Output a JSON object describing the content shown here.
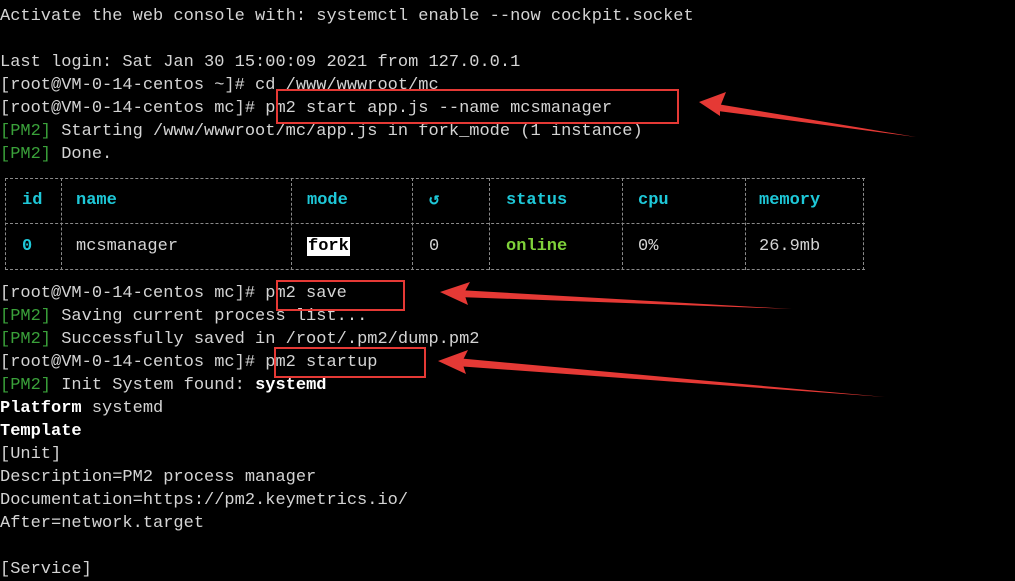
{
  "terminal": {
    "line_activate": "Activate the web console with: systemctl enable --now cockpit.socket",
    "line_lastlogin": "Last login: Sat Jan 30 15:00:09 2021 from 127.0.0.1",
    "prompt_home": "[root@VM-0-14-centos ~]#",
    "cmd_cd": " cd /www/wwwroot/mc",
    "prompt_mc": "[root@VM-0-14-centos mc]#",
    "cmd_start": " pm2 start app.js --name mcsmanager",
    "pm2_tag": "[PM2]",
    "starting_text": " Starting /www/wwwroot/mc/app.js in fork_mode (1 instance)",
    "done_text": " Done.",
    "cmd_save": " pm2 save",
    "saving_text": " Saving current process list...",
    "saved_text": " Successfully saved in /root/.pm2/dump.pm2",
    "cmd_startup": " pm2 startup",
    "init_text": " Init System found: ",
    "init_value": "systemd",
    "platform_label": "Platform",
    "platform_value": " systemd",
    "template_label": "Template",
    "unit_header": "[Unit]",
    "description_line": "Description=PM2 process manager",
    "documentation_line": "Documentation=https://pm2.keymetrics.io/",
    "after_line": "After=network.target",
    "service_header": "[Service]"
  },
  "process_table": {
    "headers": [
      "id",
      "name",
      "mode",
      "↺",
      "status",
      "cpu",
      "memory"
    ],
    "row": {
      "id": "0",
      "name": "mcsmanager",
      "mode": "fork",
      "restarts": "0",
      "status": "online",
      "cpu": "0%",
      "memory": "26.9mb"
    }
  },
  "colors": {
    "background": "#000000",
    "text": "#d4d4d4",
    "pm2_tag": "#3aa13a",
    "table_header": "#1ec8d8",
    "status_online": "#7fd23a",
    "annotation": "#e53935"
  }
}
